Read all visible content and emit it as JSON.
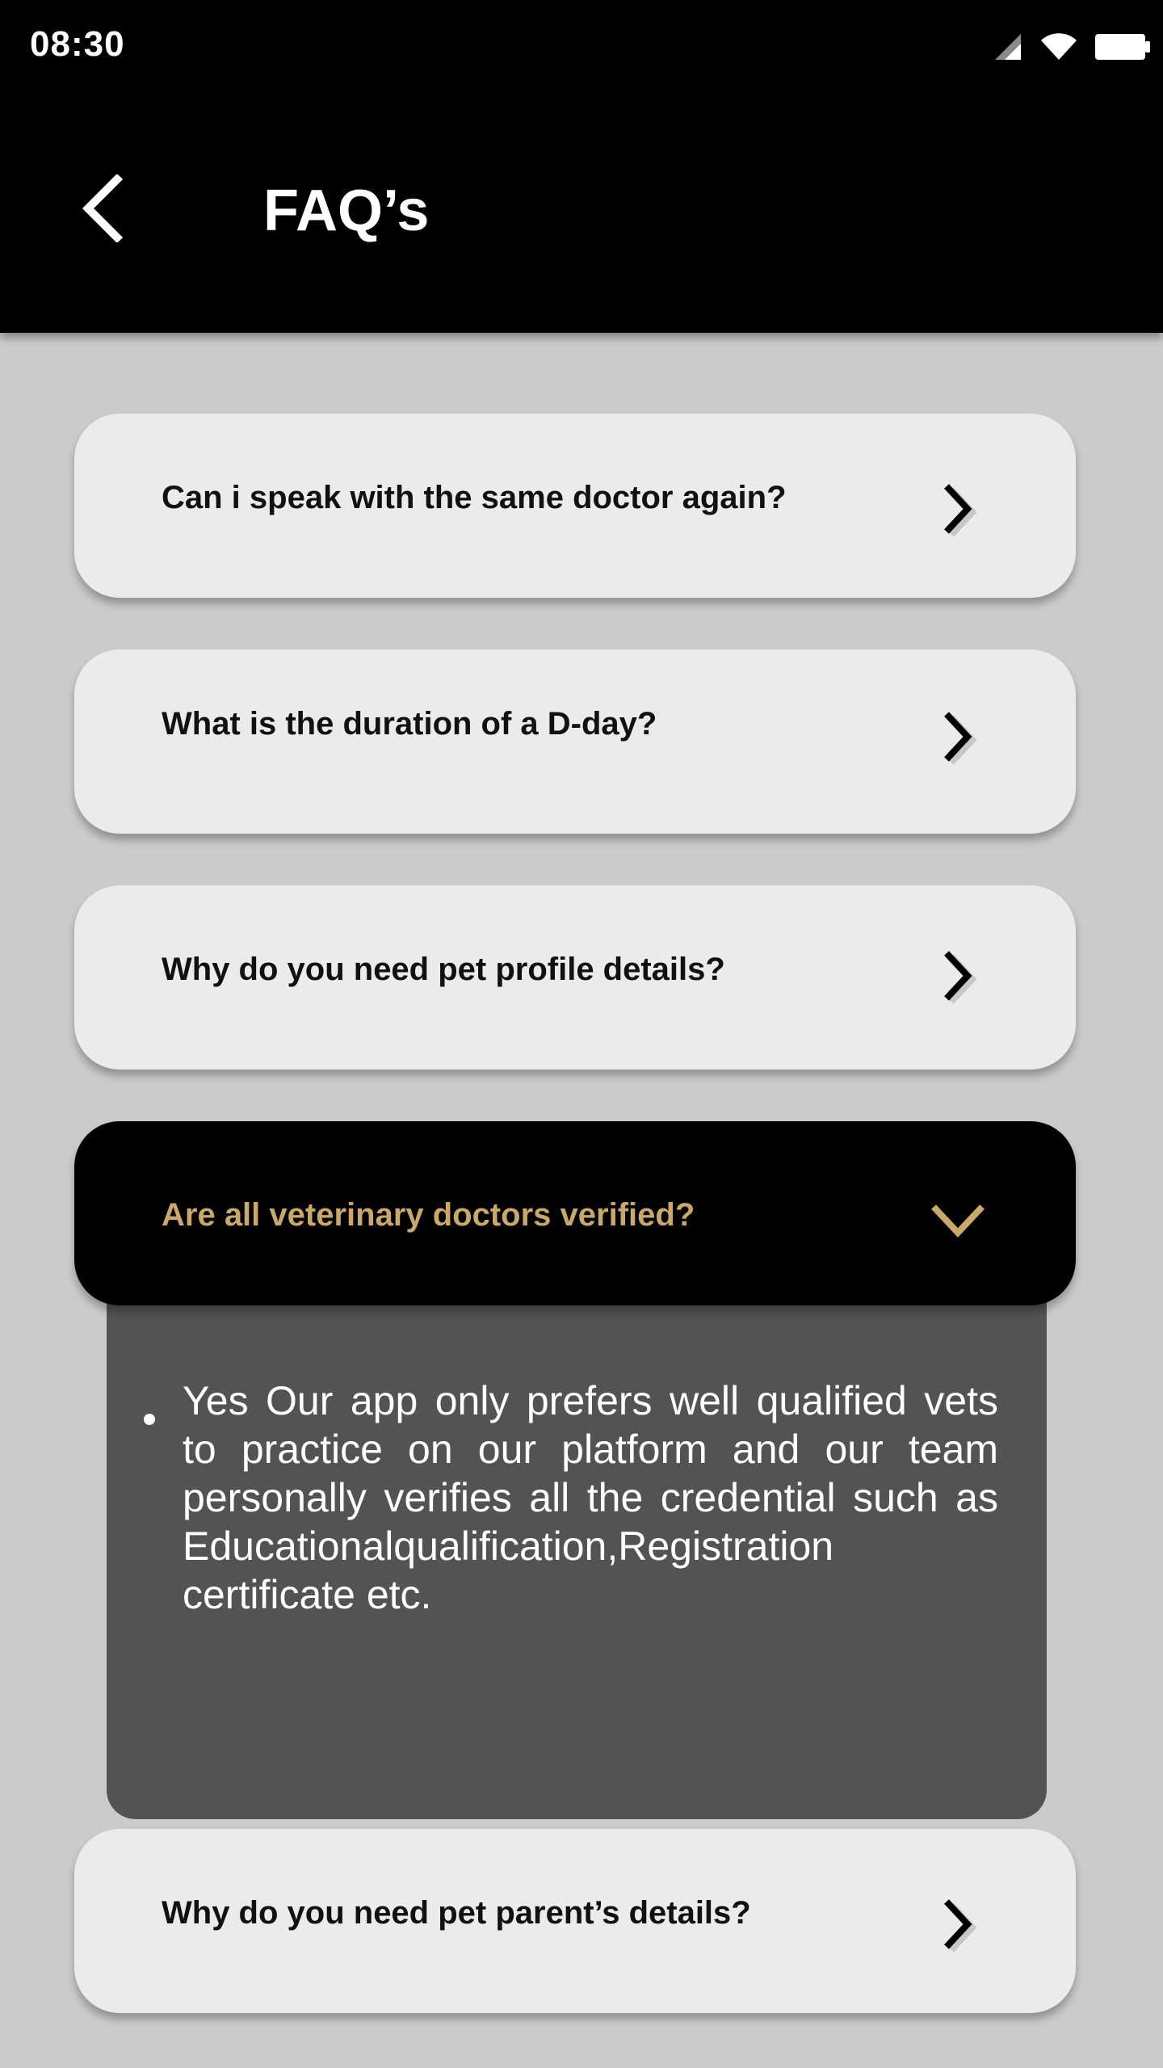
{
  "status_bar": {
    "time": "08:30",
    "icons": [
      "signal-icon",
      "wifi-icon",
      "battery-icon"
    ]
  },
  "header": {
    "title": "FAQ’s",
    "back_icon": "back-arrow-icon"
  },
  "faqs": [
    {
      "question": "Can i speak with the same doctor again?",
      "expanded": false,
      "icon": "chevron-right-icon"
    },
    {
      "question": "What is the duration of a D-day?",
      "expanded": false,
      "icon": "chevron-right-icon"
    },
    {
      "question": "Why do you need pet profile details?",
      "expanded": false,
      "icon": "chevron-right-icon"
    },
    {
      "question": "Are all veterinary doctors verified?",
      "expanded": true,
      "icon": "chevron-down-icon",
      "answer": "Yes Our app only prefers well qualified vets to practice on our platform and our team personally verifies all the credential such as Educationalqualification,Registration certificate etc."
    },
    {
      "question": "Why do you need pet parent’s details?",
      "expanded": false,
      "icon": "chevron-right-icon"
    }
  ],
  "colors": {
    "header_bg": "#000000",
    "page_bg": "#cbcbcb",
    "card_bg": "#ebebeb",
    "expanded_card_bg": "#000000",
    "expanded_question": "#c9a869",
    "answer_panel_bg": "#535353"
  }
}
